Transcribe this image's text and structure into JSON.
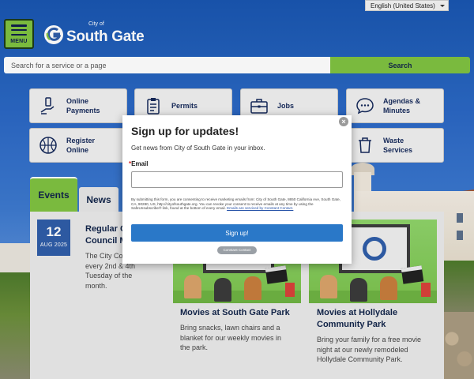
{
  "language_selector": {
    "value": "English (United States)"
  },
  "header": {
    "menu_label": "MENU",
    "logo": {
      "small": "City of",
      "big": "South Gate"
    }
  },
  "search": {
    "placeholder": "Search for a service or a page",
    "button_label": "Search"
  },
  "quick_links": [
    {
      "label_line1": "Online",
      "label_line2": "Payments",
      "icon": "payment-hand-icon"
    },
    {
      "label_line1": "Permits",
      "label_line2": "",
      "icon": "clipboard-icon"
    },
    {
      "label_line1": "Jobs",
      "label_line2": "",
      "icon": "briefcase-icon"
    },
    {
      "label_line1": "Agendas &",
      "label_line2": "Minutes",
      "icon": "chat-bubble-icon"
    },
    {
      "label_line1": "Register",
      "label_line2": "Online",
      "icon": "basketball-icon"
    },
    {
      "label_line1": "Waste",
      "label_line2": "Services",
      "icon": "trash-can-icon"
    }
  ],
  "tabs": {
    "events": "Events",
    "news": "News"
  },
  "events": [
    {
      "day": "12",
      "month_year": "AUG 2025",
      "title_line1": "Regular C",
      "title_line2": "Council M",
      "description": "The City Co meets every 2nd & 4th Tuesday of the month."
    },
    {
      "title": "Movies at South Gate Park",
      "description": "Bring snacks, lawn chairs and a blanket for our weekly movies in the park."
    },
    {
      "title_line1": "Movies at Hollydale",
      "title_line2": "Community Park",
      "description": "Bring your family for a free movie night at our newly remodeled Hollydale Community Park."
    }
  ],
  "modal": {
    "title": "Sign up for updates!",
    "subtitle": "Get news from City of South Gate in your inbox.",
    "email_label": "Email",
    "email_required_mark": "*",
    "email_value": "",
    "legal_text": "By submitting this form, you are consenting to receive marketing emails from: City of South Gate, 8650 California Ave, South Gate, CA, 90280, US, http://cityofsouthgate.org. You can revoke your consent to receive emails at any time by using the SafeUnsubscribe® link, found at the bottom of every email.",
    "legal_link": "Emails are serviced by Constant Contact.",
    "signup_label": "Sign up!",
    "badge": "Constant Contact",
    "close_label": "×"
  },
  "colors": {
    "accent_green": "#7fc241",
    "navy": "#12254a",
    "date_blue": "#2f5da8",
    "signup_blue": "#2a78c8"
  }
}
